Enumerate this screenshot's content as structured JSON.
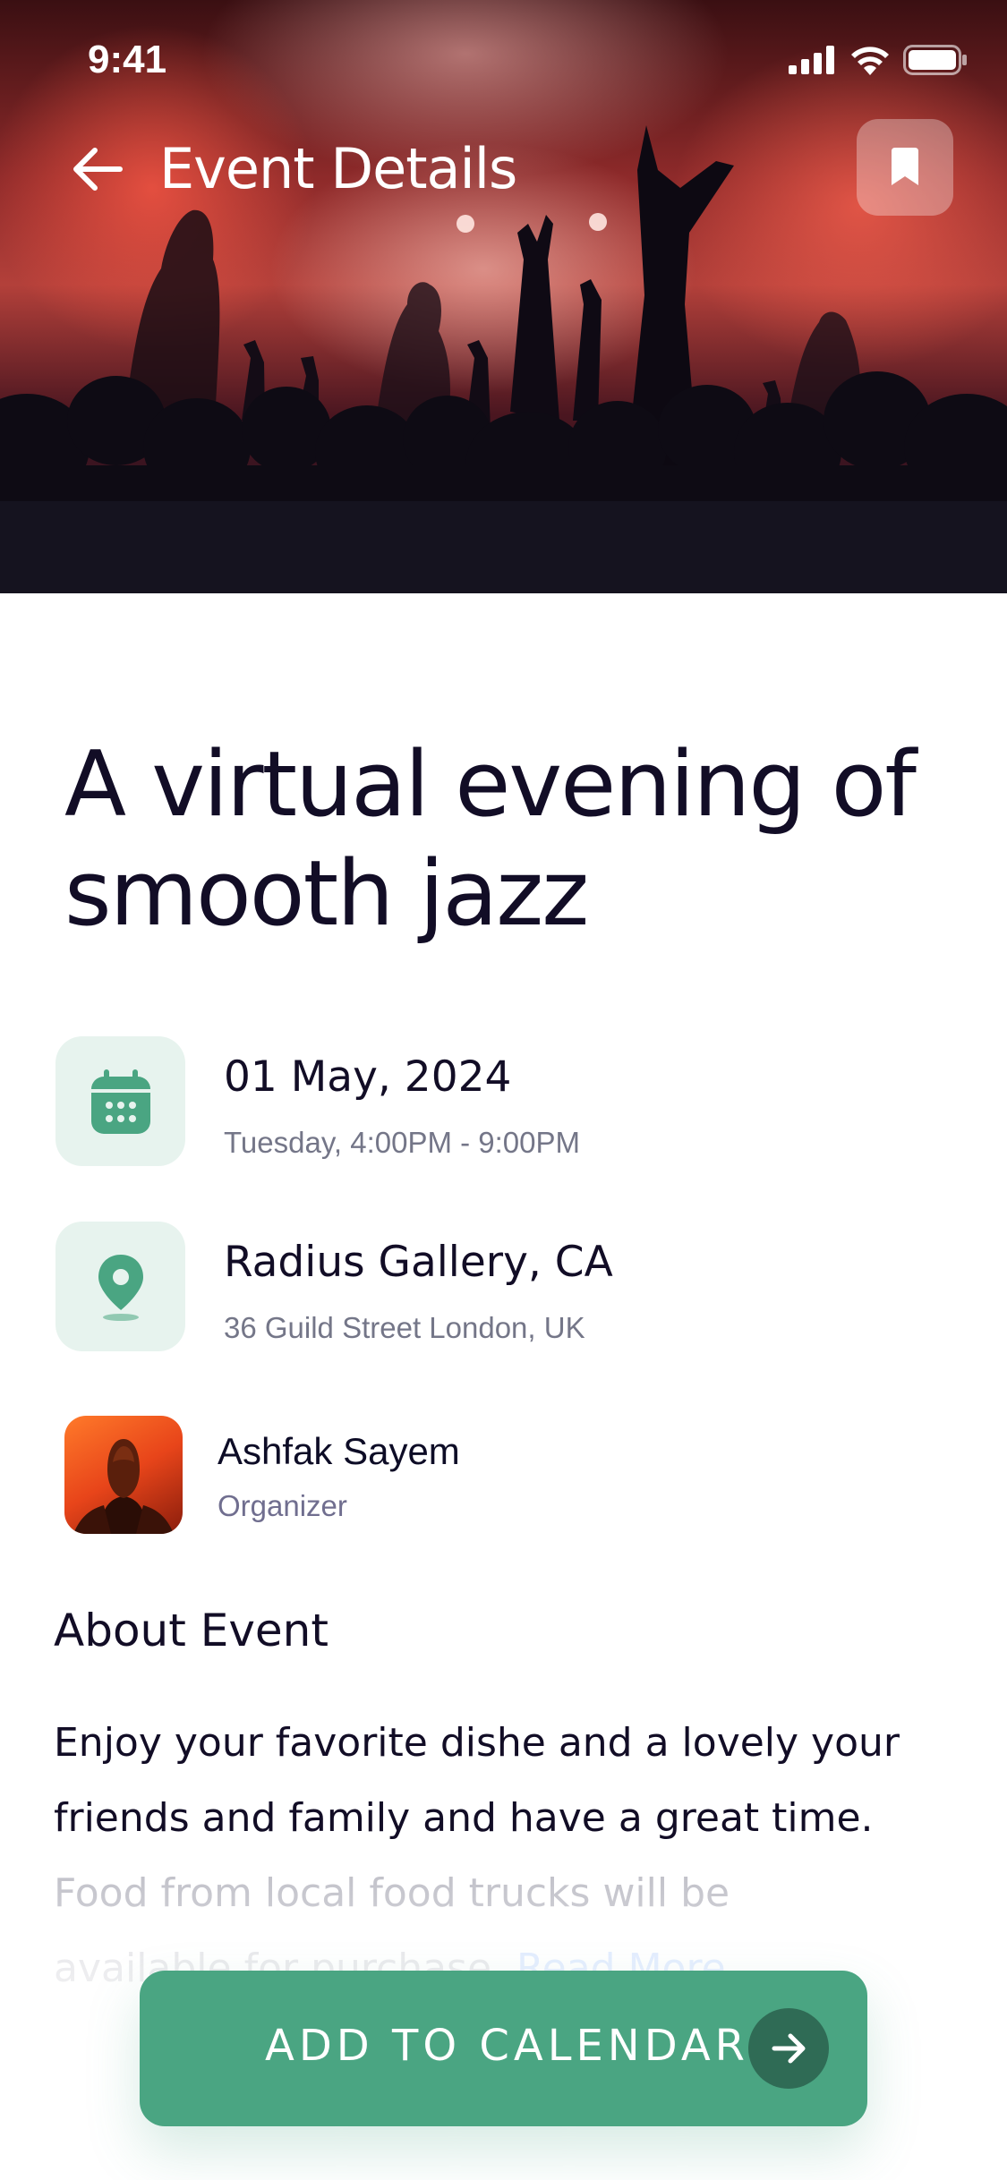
{
  "status_bar": {
    "time": "9:41",
    "icons": [
      "signal-icon",
      "wifi-icon",
      "battery-icon"
    ]
  },
  "header": {
    "back_icon": "arrow-left-icon",
    "title": "Event Details",
    "bookmark_icon": "bookmark-icon"
  },
  "event": {
    "title_line1": "A virtual evening of",
    "title_line2": "smooth jazz",
    "date": {
      "icon": "calendar-icon",
      "primary": "01 May, 2024",
      "secondary": "Tuesday, 4:00PM - 9:00PM"
    },
    "location": {
      "icon": "location-pin-icon",
      "primary": "Radius Gallery, CA",
      "secondary": "36 Guild Street London, UK"
    },
    "organizer": {
      "name": "Ashfak Sayem",
      "role": "Organizer"
    }
  },
  "about": {
    "heading": "About Event",
    "line1": "Enjoy your favorite dishe and a lovely your",
    "line2": "friends and family and have a great time.",
    "line3": "Food from local food trucks will be",
    "line4": "available for purchase.",
    "read_more": "Read More"
  },
  "cta": {
    "label": "ADD TO CALENDAR",
    "icon": "arrow-right-icon"
  },
  "colors": {
    "accent": "#4AA582",
    "accent_dark": "#2F6B55",
    "icon_tile": "#E7F3EE",
    "text_primary": "#120D26",
    "text_secondary": "#747688"
  }
}
